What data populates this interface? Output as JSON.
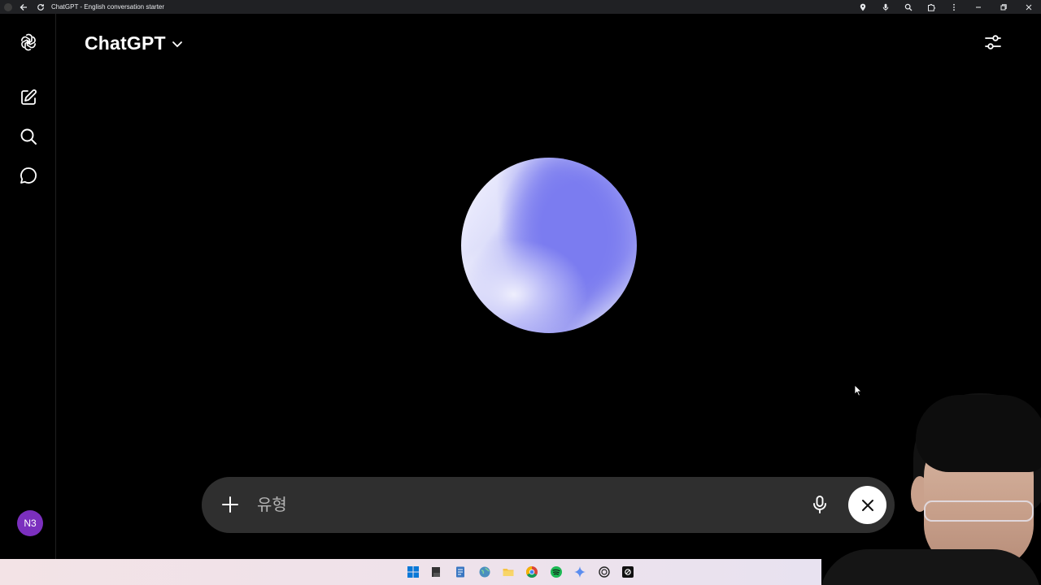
{
  "browser": {
    "tab_title": "ChatGPT - English conversation starter"
  },
  "header": {
    "model_name": "ChatGPT"
  },
  "sidebar": {
    "items": [
      {
        "name": "openai-logo-icon"
      },
      {
        "name": "new-chat-icon"
      },
      {
        "name": "search-icon"
      },
      {
        "name": "chat-history-icon"
      }
    ],
    "avatar_initials": "N3",
    "avatar_color": "#7b2fbe"
  },
  "composer": {
    "placeholder": "유형",
    "value": ""
  },
  "colors": {
    "background": "#000000",
    "composer_bg": "#2f2f2f",
    "orb_primary": "#7b7cf0",
    "orb_highlight": "#f4f4ff"
  },
  "taskbar": {
    "apps": [
      "windows-start-icon",
      "notepad-icon",
      "notes-icon",
      "earth-icon",
      "file-explorer-icon",
      "chrome-icon",
      "spotify-icon",
      "gemini-icon",
      "chatgpt-app-icon",
      "chatgpt-dark-icon"
    ]
  }
}
